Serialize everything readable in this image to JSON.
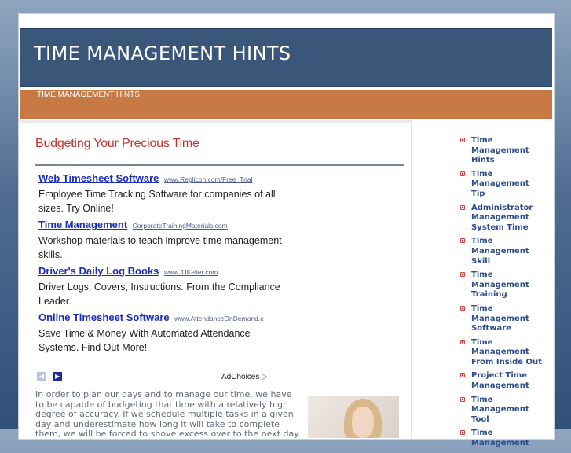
{
  "header": {
    "site_title": "TIME MANAGEMENT HINTS"
  },
  "nav": {
    "items": [
      {
        "label": "TIME MANAGEMENT HINTS"
      }
    ]
  },
  "post": {
    "title": "Budgeting Your Precious Time"
  },
  "ads": [
    {
      "title": "Web Timesheet Software",
      "url": "www.Replicon.com/Free_Trial",
      "desc": "Employee Time Tracking Software for companies of all sizes. Try Online!"
    },
    {
      "title": "Time Management",
      "url": "CorporateTrainingMaterials.com",
      "desc": "Workshop materials to teach improve time management skills."
    },
    {
      "title": "Driver's Daily Log Books",
      "url": "www.JJKeller.com",
      "desc": "Driver Logs, Covers, Instructions. From the Compliance Leader."
    },
    {
      "title": "Online Timesheet Software",
      "url": "www.AttendanceOnDemand.c",
      "desc": "Save Time & Money With Automated Attendance Systems. Find Out More!"
    }
  ],
  "ad_nav": {
    "prev_icon": "chevron-left-icon",
    "next_icon": "chevron-right-icon",
    "adchoices_label": "AdChoices",
    "adchoices_icon": "adchoices-icon"
  },
  "article": {
    "text": "In order to plan our days and to manage our time, we have to be capable of budgeting that time with a relatively high degree of accuracy. If we schedule multiple tasks in a given day and underestimate how long it will take to complete them, we will be forced to shove excess over to the next day. Invariably, it seems,"
  },
  "sidebar": {
    "links": [
      {
        "label": "Time Management Hints"
      },
      {
        "label": "Time Management Tip"
      },
      {
        "label": "Administrator Management System Time"
      },
      {
        "label": "Time Management Skill"
      },
      {
        "label": "Time Management Training"
      },
      {
        "label": "Time Management Software"
      },
      {
        "label": "Time Management From Inside Out"
      },
      {
        "label": "Project Time Management"
      },
      {
        "label": "Time Management Tool"
      },
      {
        "label": "Time Management"
      }
    ]
  },
  "colors": {
    "header_bg": "#3a5679",
    "nav_bg": "#c87a45",
    "post_title": "#c0352b",
    "ad_link": "#1b2db4",
    "sidebar_link": "#2b4e8a"
  }
}
